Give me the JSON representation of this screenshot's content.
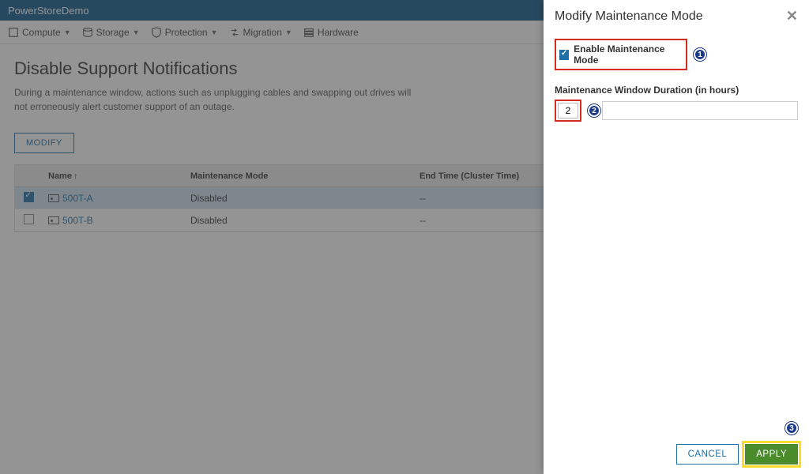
{
  "topbar": {
    "brand": "PowerStoreDemo"
  },
  "menus": [
    {
      "id": "compute",
      "label": "Compute",
      "hasCaret": true
    },
    {
      "id": "storage",
      "label": "Storage",
      "hasCaret": true
    },
    {
      "id": "protection",
      "label": "Protection",
      "hasCaret": true
    },
    {
      "id": "migration",
      "label": "Migration",
      "hasCaret": true
    },
    {
      "id": "hardware",
      "label": "Hardware",
      "hasCaret": false
    }
  ],
  "page": {
    "title": "Disable Support Notifications",
    "desc": "During a maintenance window, actions such as unplugging cables and swapping out drives will not erroneously alert customer support of an outage.",
    "modify_btn": "MODIFY"
  },
  "table": {
    "headers": {
      "name": "Name",
      "mm": "Maintenance Mode",
      "end": "End Time (Cluster Time)"
    },
    "rows": [
      {
        "selected": true,
        "name": "500T-A",
        "mm": "Disabled",
        "end": "--"
      },
      {
        "selected": false,
        "name": "500T-B",
        "mm": "Disabled",
        "end": "--"
      }
    ]
  },
  "panel": {
    "title": "Modify Maintenance Mode",
    "enable_label": "Enable Maintenance Mode",
    "duration_label": "Maintenance Window Duration (in hours)",
    "duration_value": "2",
    "cancel": "CANCEL",
    "apply": "APPLY"
  },
  "callouts": {
    "one": "1",
    "two": "2",
    "three": "3"
  }
}
